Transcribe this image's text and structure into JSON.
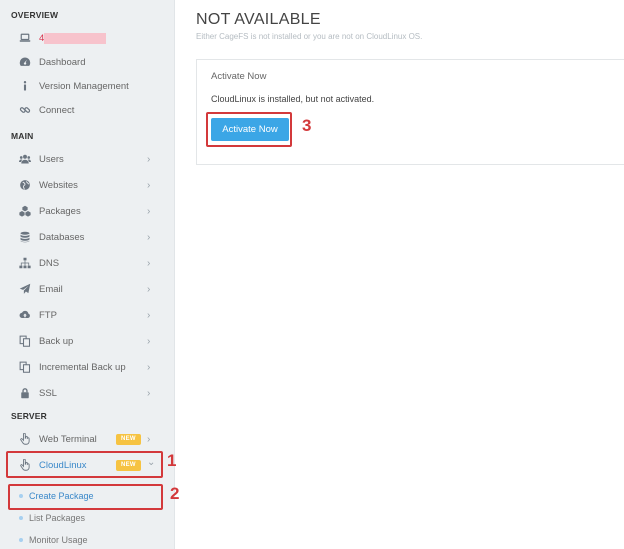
{
  "sidebar": {
    "overview_header": "OVERVIEW",
    "hostname_prefix": "4",
    "overview_items": [
      {
        "label": "Dashboard",
        "icon": "dashboard-icon"
      },
      {
        "label": "Version Management",
        "icon": "info-icon"
      },
      {
        "label": "Connect",
        "icon": "link-icon"
      }
    ],
    "main_header": "MAIN",
    "main_items": [
      {
        "label": "Users",
        "icon": "users-icon"
      },
      {
        "label": "Websites",
        "icon": "globe-icon"
      },
      {
        "label": "Packages",
        "icon": "cubes-icon"
      },
      {
        "label": "Databases",
        "icon": "database-icon"
      },
      {
        "label": "DNS",
        "icon": "sitemap-icon"
      },
      {
        "label": "Email",
        "icon": "paper-plane-icon"
      },
      {
        "label": "FTP",
        "icon": "cloud-upload-icon"
      },
      {
        "label": "Back up",
        "icon": "copy-icon"
      },
      {
        "label": "Incremental Back up",
        "icon": "copy-icon"
      },
      {
        "label": "SSL",
        "icon": "lock-icon"
      }
    ],
    "server_header": "SERVER",
    "server_items": [
      {
        "label": "Web Terminal",
        "icon": "hand-pointer-icon",
        "badge": "NEW"
      },
      {
        "label": "CloudLinux",
        "icon": "hand-pointer-icon",
        "badge": "NEW"
      }
    ],
    "cloudlinux_sub_items": [
      {
        "label": "Create Package"
      },
      {
        "label": "List Packages"
      },
      {
        "label": "Monitor Usage"
      }
    ],
    "chevron": "›",
    "chevron_open": "⌄"
  },
  "main": {
    "title": "NOT AVAILABLE",
    "subtitle": "Either CageFS is not installed or you are not on CloudLinux OS.",
    "panel": {
      "heading": "Activate Now",
      "message": "CloudLinux is installed, but not activated.",
      "button_label": "Activate Now"
    }
  },
  "callouts": [
    "1",
    "2",
    "3"
  ],
  "colors": {
    "accent_blue": "#3ba6e6",
    "callout_red": "#d3393b",
    "badge_yellow": "#f6c342",
    "sidebar_bg": "#edf0f2"
  }
}
